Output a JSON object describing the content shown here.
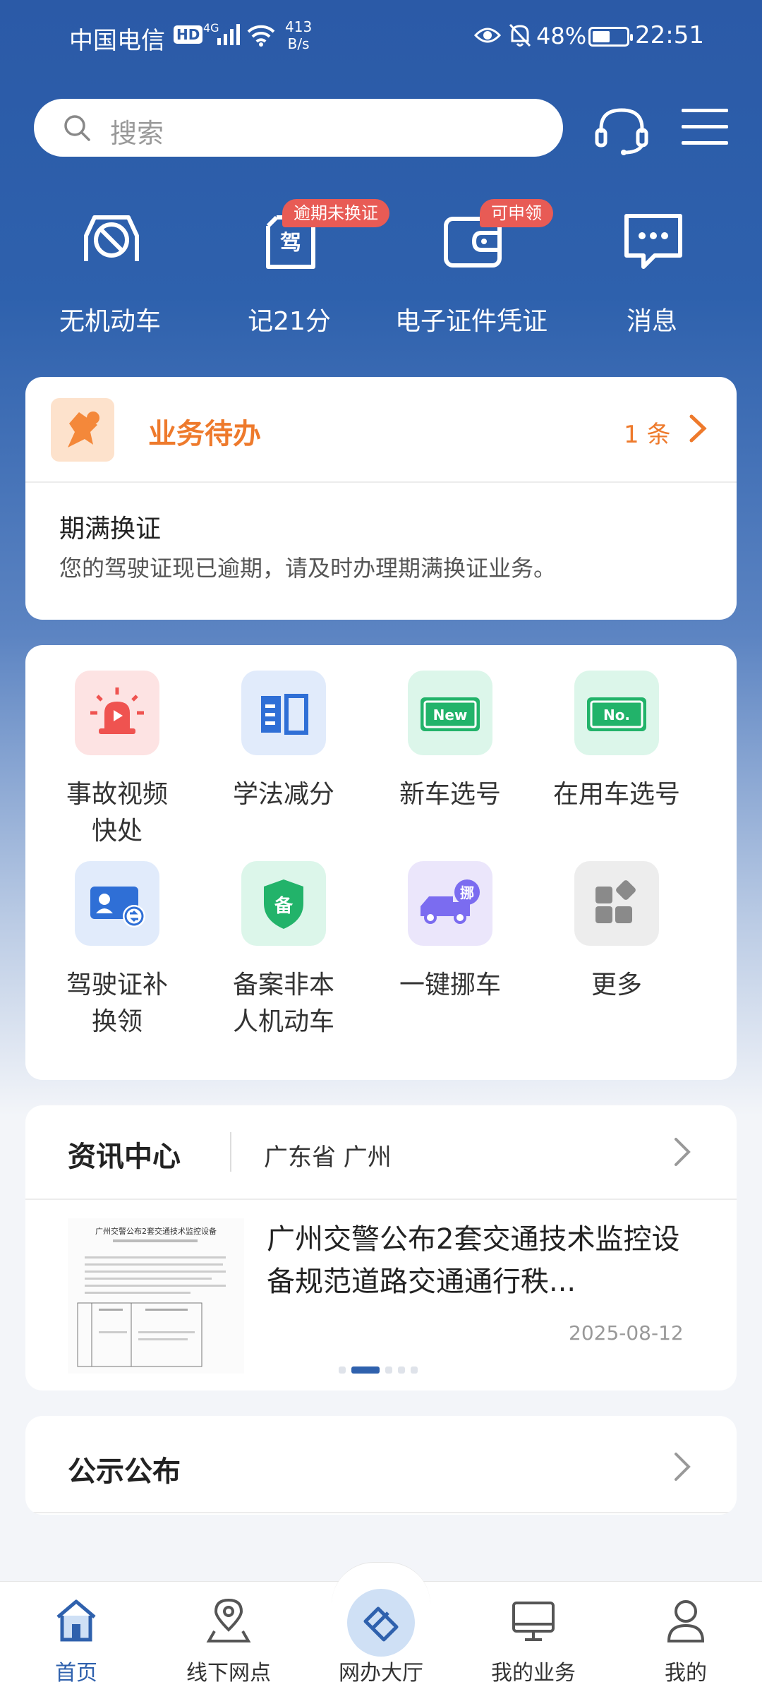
{
  "status_bar": {
    "carrier": "中国电信",
    "hd": "HD",
    "network": "4G",
    "speed_value": "413",
    "speed_unit": "B/s",
    "battery": "48%",
    "time": "22:51"
  },
  "search": {
    "placeholder": "搜索"
  },
  "quick_actions": [
    {
      "label": "无机动车",
      "icon": "car-crossed-icon",
      "badge": ""
    },
    {
      "label": "记21分",
      "icon": "license-icon",
      "badge": "逾期未换证"
    },
    {
      "label": "电子证件凭证",
      "icon": "wallet-icon",
      "badge": "可申领"
    },
    {
      "label": "消息",
      "icon": "message-icon",
      "badge": ""
    }
  ],
  "todo": {
    "title": "业务待办",
    "count": "1 条",
    "item_title": "期满换证",
    "item_desc": "您的驾驶证现已逾期，请及时办理期满换证业务。",
    "accent": "#ee7a2c"
  },
  "services": [
    {
      "label": "事故视频快处",
      "icon": "alarm-light-icon"
    },
    {
      "label": "学法减分",
      "icon": "book-icon"
    },
    {
      "label": "新车选号",
      "icon": "new-plate-icon"
    },
    {
      "label": "在用车选号",
      "icon": "plate-number-icon"
    },
    {
      "label": "驾驶证补换领",
      "icon": "license-renew-icon"
    },
    {
      "label": "备案非本人机动车",
      "icon": "shield-icon"
    },
    {
      "label": "一键挪车",
      "icon": "move-car-icon"
    },
    {
      "label": "更多",
      "icon": "more-apps-icon"
    }
  ],
  "news": {
    "title": "资讯中心",
    "location": "广东省 广州",
    "headline": "广州交警公布2套交通技术监控设备规范道路交通通行秩...",
    "date": "2025-08-12",
    "thumb_title": "广州交警公布2套交通技术监控设备"
  },
  "notice": {
    "title": "公示公布"
  },
  "tabs": [
    {
      "label": "首页",
      "icon": "home-icon",
      "active": true
    },
    {
      "label": "线下网点",
      "icon": "map-pin-icon",
      "active": false
    },
    {
      "label": "网办大厅",
      "icon": "hall-icon",
      "active": false
    },
    {
      "label": "我的业务",
      "icon": "monitor-icon",
      "active": false
    },
    {
      "label": "我的",
      "icon": "user-icon",
      "active": false
    }
  ],
  "colors": {
    "primary": "#2f61ad",
    "badge": "#e85b55"
  }
}
